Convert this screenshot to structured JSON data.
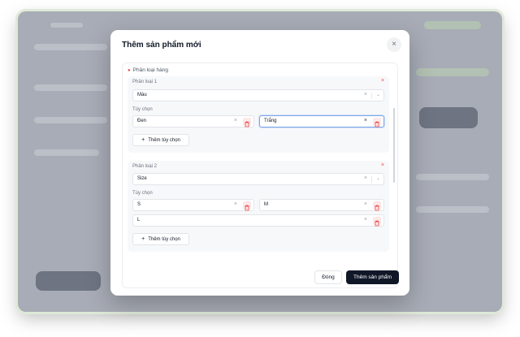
{
  "modal": {
    "title": "Thêm sản phẩm mới",
    "close_icon": "×",
    "section_label": "Phân loại hàng",
    "groups": [
      {
        "label": "Phân loại 1",
        "select_value": "Màu",
        "options_label": "Tùy chọn",
        "options": [
          "Đen",
          "Trắng"
        ],
        "add_label": "Thêm tùy chọn"
      },
      {
        "label": "Phân loại 2",
        "select_value": "Size",
        "options_label": "Tùy chọn",
        "options": [
          "S",
          "M",
          "L"
        ],
        "add_label": "Thêm tùy chọn"
      }
    ],
    "footer": {
      "close_label": "Đóng",
      "submit_label": "Thêm sản phẩm"
    }
  },
  "icons": {
    "remove": "×",
    "chevron": "⌄",
    "plus": "+"
  },
  "colors": {
    "accent_dark": "#101828",
    "danger": "#ef4444",
    "focus": "#7ea6e6"
  }
}
